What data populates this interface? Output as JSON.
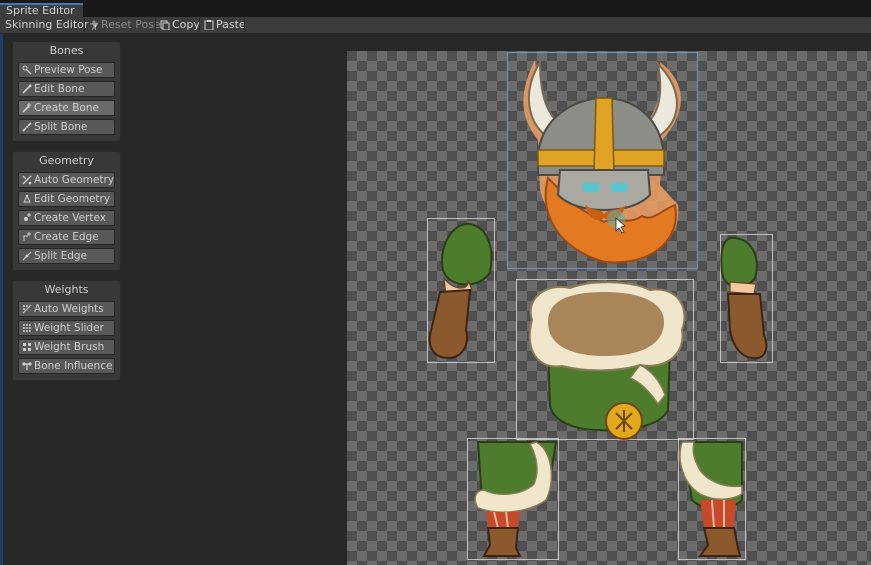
{
  "window": {
    "tab_title": "Sprite Editor"
  },
  "toolbar": {
    "mode_label": "Skinning Editor",
    "reset_pose_label": "Reset Pose",
    "copy_label": "Copy",
    "paste_label": "Paste"
  },
  "panels": {
    "bones": {
      "title": "Bones",
      "items": [
        {
          "label": "Preview Pose",
          "icon": "preview-pose-icon"
        },
        {
          "label": "Edit Bone",
          "icon": "edit-bone-icon"
        },
        {
          "label": "Create Bone",
          "icon": "create-bone-icon",
          "active": true
        },
        {
          "label": "Split Bone",
          "icon": "split-bone-icon"
        }
      ]
    },
    "geometry": {
      "title": "Geometry",
      "items": [
        {
          "label": "Auto Geometry",
          "icon": "auto-geometry-icon"
        },
        {
          "label": "Edit Geometry",
          "icon": "edit-geometry-icon"
        },
        {
          "label": "Create Vertex",
          "icon": "create-vertex-icon"
        },
        {
          "label": "Create Edge",
          "icon": "create-edge-icon"
        },
        {
          "label": "Split Edge",
          "icon": "split-edge-icon"
        }
      ]
    },
    "weights": {
      "title": "Weights",
      "items": [
        {
          "label": "Auto Weights",
          "icon": "auto-weights-icon"
        },
        {
          "label": "Weight Slider",
          "icon": "weight-slider-icon"
        },
        {
          "label": "Weight Brush",
          "icon": "weight-brush-icon"
        },
        {
          "label": "Bone Influence",
          "icon": "bone-influence-icon"
        }
      ]
    }
  },
  "colors": {
    "accent": "#3a79bb",
    "selection_outline": "#6f8fb0",
    "sprite_outline": "#d9d9d9",
    "fur": "#f0e6cc",
    "beard": "#e37a22",
    "tunic": "#4c7a2a",
    "emblem": "#e4a81e"
  }
}
